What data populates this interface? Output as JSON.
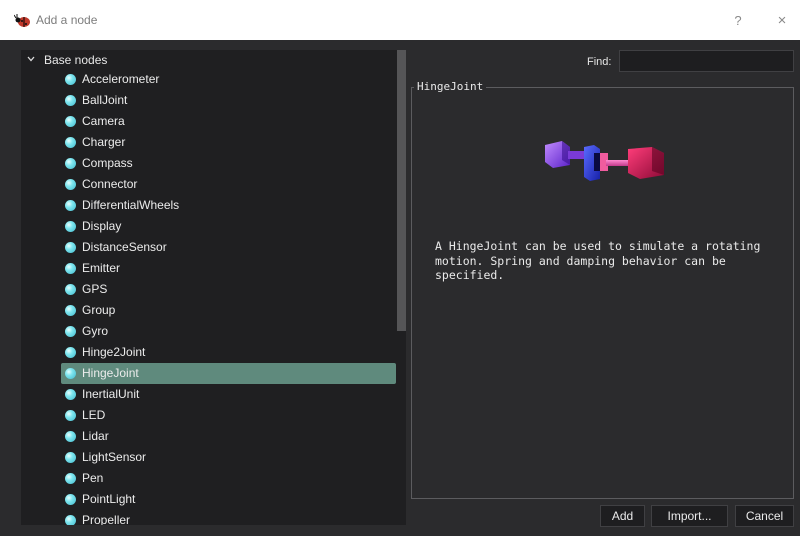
{
  "window": {
    "title": "Add a node",
    "help_label": "?",
    "close_label": "×"
  },
  "tree": {
    "root_label": "Base nodes",
    "items": [
      {
        "label": "Accelerometer"
      },
      {
        "label": "BallJoint"
      },
      {
        "label": "Camera"
      },
      {
        "label": "Charger"
      },
      {
        "label": "Compass"
      },
      {
        "label": "Connector"
      },
      {
        "label": "DifferentialWheels"
      },
      {
        "label": "Display"
      },
      {
        "label": "DistanceSensor"
      },
      {
        "label": "Emitter"
      },
      {
        "label": "GPS"
      },
      {
        "label": "Group"
      },
      {
        "label": "Gyro"
      },
      {
        "label": "Hinge2Joint"
      },
      {
        "label": "HingeJoint",
        "selected": true
      },
      {
        "label": "InertialUnit"
      },
      {
        "label": "LED"
      },
      {
        "label": "Lidar"
      },
      {
        "label": "LightSensor"
      },
      {
        "label": "Pen"
      },
      {
        "label": "PointLight"
      },
      {
        "label": "Propeller"
      }
    ]
  },
  "find": {
    "label": "Find:",
    "value": ""
  },
  "info": {
    "title": "HingeJoint",
    "description": "A HingeJoint can be used to simulate a rotating motion. Spring and damping behavior can be specified."
  },
  "buttons": {
    "add": "Add",
    "import": "Import...",
    "cancel": "Cancel"
  },
  "colors": {
    "background": "#2b2b2d",
    "panel": "#1f1f21",
    "selection": "#5f8a7d",
    "node_dot": "#4fc3d6"
  }
}
